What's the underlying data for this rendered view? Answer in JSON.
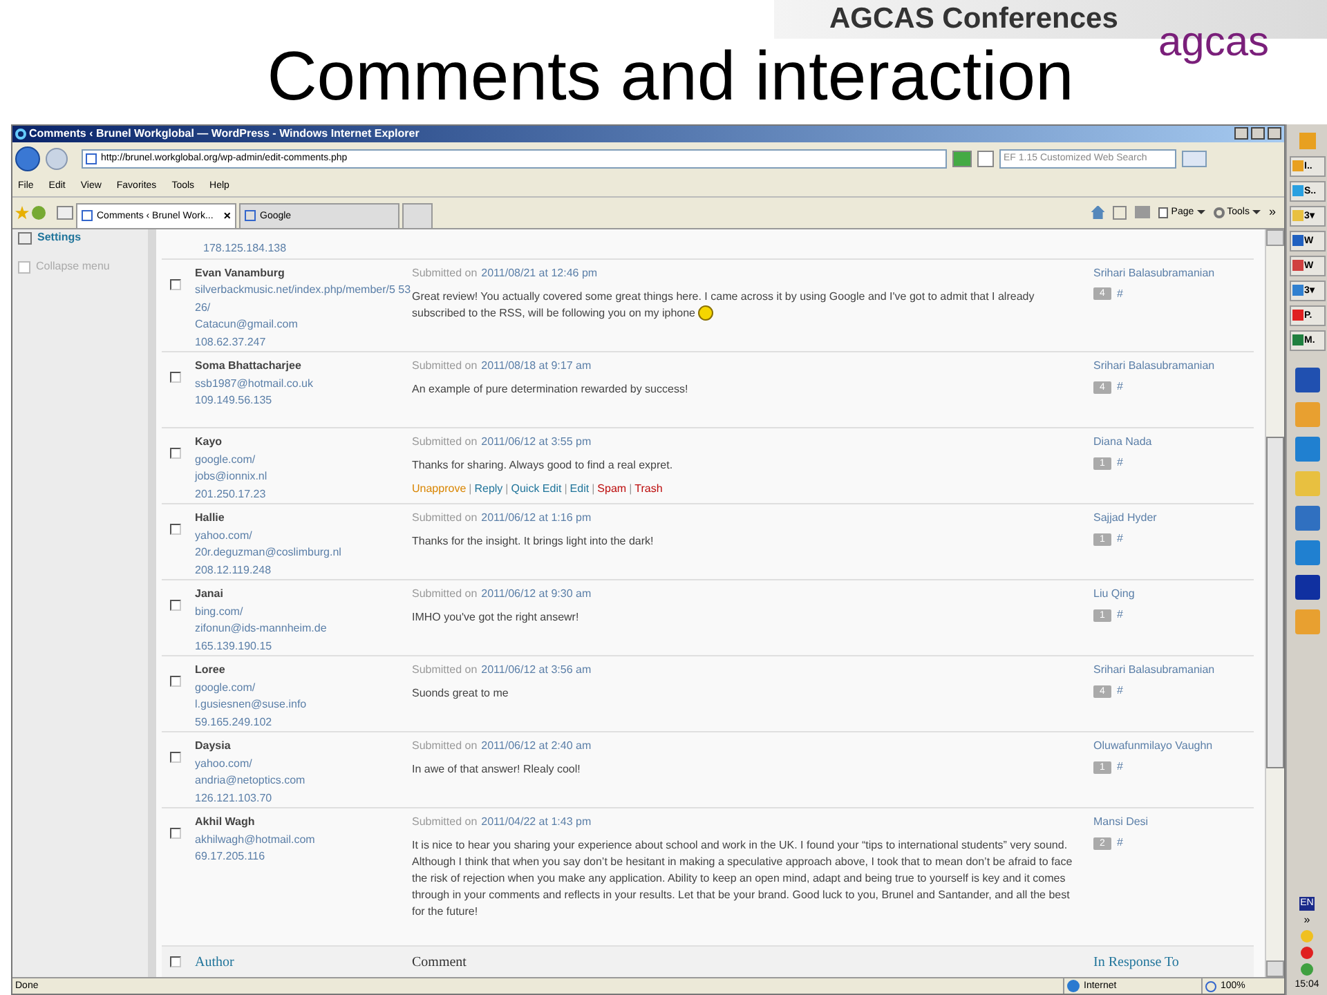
{
  "slide": {
    "title": "Comments and interaction",
    "banner": "AGCAS Conferences",
    "logo": "agcas"
  },
  "browser": {
    "title": "Comments ‹ Brunel Workglobal — WordPress - Windows Internet Explorer",
    "url": "http://brunel.workglobal.org/wp-admin/edit-comments.php",
    "search_placeholder": "EF 1.15 Customized Web Search",
    "menu": [
      "File",
      "Edit",
      "View",
      "Favorites",
      "Tools",
      "Help"
    ],
    "tabs": [
      {
        "label": "Comments ‹ Brunel Work...",
        "selected": true,
        "close": "×"
      },
      {
        "label": "Google",
        "selected": false
      }
    ],
    "commands": [
      {
        "label": "Page",
        "kind": "page"
      },
      {
        "label": "Tools",
        "kind": "tools"
      }
    ],
    "more": "»",
    "status": "Done",
    "zone": "Internet",
    "zoom": "100%"
  },
  "sidebar": {
    "items": [
      {
        "label": "Settings",
        "kind": "section"
      },
      {
        "label": "Collapse menu",
        "kind": "collapse"
      }
    ]
  },
  "partial_row": {
    "ip": "178.125.184.138"
  },
  "action_separator": "|",
  "rows": [
    {
      "checked": false,
      "author": "Evan Vanamburg",
      "links": [
        "silverbackmusic.net/index.php/member/5 5326/",
        "Catacun@gmail.com",
        "108.62.37.247"
      ],
      "submitted": "Submitted on",
      "date": "2011/08/21 at 12:46 pm",
      "text": "Great review! You actually covered some great things here. I came across it by using Google and I've got to admit that I already subscribed to the RSS, will be following you on my iphone",
      "smiley": true,
      "response": "Srihari Balasubramanian",
      "count": "4",
      "hash": "#"
    },
    {
      "checked": false,
      "author": "Soma Bhattacharjee",
      "links": [
        "ssb1987@hotmail.co.uk",
        "109.149.56.135"
      ],
      "submitted": "Submitted on",
      "date": "2011/08/18 at 9:17 am",
      "text": "An example of pure determination rewarded by success!",
      "smiley": false,
      "response": "Srihari Balasubramanian",
      "count": "4",
      "hash": "#"
    },
    {
      "checked": false,
      "author": "Kayo",
      "links": [
        "google.com/",
        "jobs@ionnix.nl",
        "201.250.17.23"
      ],
      "submitted": "Submitted on",
      "date": "2011/06/12 at 3:55 pm",
      "text": "Thanks for sharing. Always good to find a real expret.",
      "smiley": false,
      "actions": [
        {
          "label": "Unapprove",
          "kind": "warn"
        },
        {
          "label": "Reply",
          "kind": "normal"
        },
        {
          "label": "Quick Edit",
          "kind": "normal"
        },
        {
          "label": "Edit",
          "kind": "normal"
        },
        {
          "label": "Spam",
          "kind": "danger"
        },
        {
          "label": "Trash",
          "kind": "danger"
        }
      ],
      "response": "Diana Nada",
      "count": "1",
      "hash": "#"
    },
    {
      "checked": false,
      "author": "Hallie",
      "links": [
        "yahoo.com/",
        "20r.deguzman@coslimburg.nl",
        "208.12.119.248"
      ],
      "submitted": "Submitted on",
      "date": "2011/06/12 at 1:16 pm",
      "text": "Thanks for the insight. It brings light into the dark!",
      "smiley": false,
      "response": "Sajjad Hyder",
      "count": "1",
      "hash": "#"
    },
    {
      "checked": false,
      "author": "Janai",
      "links": [
        "bing.com/",
        "zifonun@ids-mannheim.de",
        "165.139.190.15"
      ],
      "submitted": "Submitted on",
      "date": "2011/06/12 at 9:30 am",
      "text": "IMHO you've got the right ansewr!",
      "smiley": false,
      "response": "Liu Qing",
      "count": "1",
      "hash": "#"
    },
    {
      "checked": false,
      "author": "Loree",
      "links": [
        "google.com/",
        "l.gusiesnen@suse.info",
        "59.165.249.102"
      ],
      "submitted": "Submitted on",
      "date": "2011/06/12 at 3:56 am",
      "text": "Suonds great to me",
      "smiley": false,
      "response": "Srihari Balasubramanian",
      "count": "4",
      "hash": "#"
    },
    {
      "checked": false,
      "author": "Daysia",
      "links": [
        "yahoo.com/",
        "andria@netoptics.com",
        "126.121.103.70"
      ],
      "submitted": "Submitted on",
      "date": "2011/06/12 at 2:40 am",
      "text": "In awe of that answer! Rlealy cool!",
      "smiley": false,
      "response": "Oluwafunmilayo Vaughn",
      "count": "1",
      "hash": "#"
    },
    {
      "checked": false,
      "author": "Akhil Wagh",
      "links": [
        "akhilwagh@hotmail.com",
        "69.17.205.116"
      ],
      "submitted": "Submitted on",
      "date": "2011/04/22 at 1:43 pm",
      "text": "It is nice to hear you sharing your experience about school and work in the UK. I found your “tips to international students” very sound. Although I think that when you say don’t be hesitant in making a speculative approach above, I took that to mean don’t be afraid to face the risk of rejection when you make any application. Ability to keep an open mind, adapt and being true to yourself is key and it comes through in your comments and reflects in your results. Let that be your brand. Good luck to you, Brunel and Santander, and all the best for the future!",
      "smiley": false,
      "response": "Mansi Desi",
      "count": "2",
      "hash": "#"
    }
  ],
  "footer": {
    "checked": false,
    "author": "Author",
    "comment": "Comment",
    "response": "In Response To"
  },
  "taskbar": {
    "items": [
      {
        "label": "I..",
        "color": "#e8a020"
      },
      {
        "label": "S..",
        "color": "#2aa0e0"
      },
      {
        "label": "3▾",
        "color": "#e8c040"
      },
      {
        "label": "W",
        "color": "#2060c0"
      },
      {
        "label": "W",
        "color": "#d04040"
      },
      {
        "label": "3▾",
        "color": "#3080d0"
      },
      {
        "label": "P.",
        "color": "#e02020"
      },
      {
        "label": "M.",
        "color": "#208040"
      }
    ],
    "apps": [
      {
        "color": "#2050b0"
      },
      {
        "color": "#e8a030"
      },
      {
        "color": "#2080d0"
      },
      {
        "color": "#e8c040"
      },
      {
        "color": "#3070c0"
      },
      {
        "color": "#2080d0"
      },
      {
        "color": "#1030a0"
      },
      {
        "color": "#e8a030"
      }
    ],
    "lang": "EN",
    "chevron": "»",
    "clock": "15:04"
  }
}
